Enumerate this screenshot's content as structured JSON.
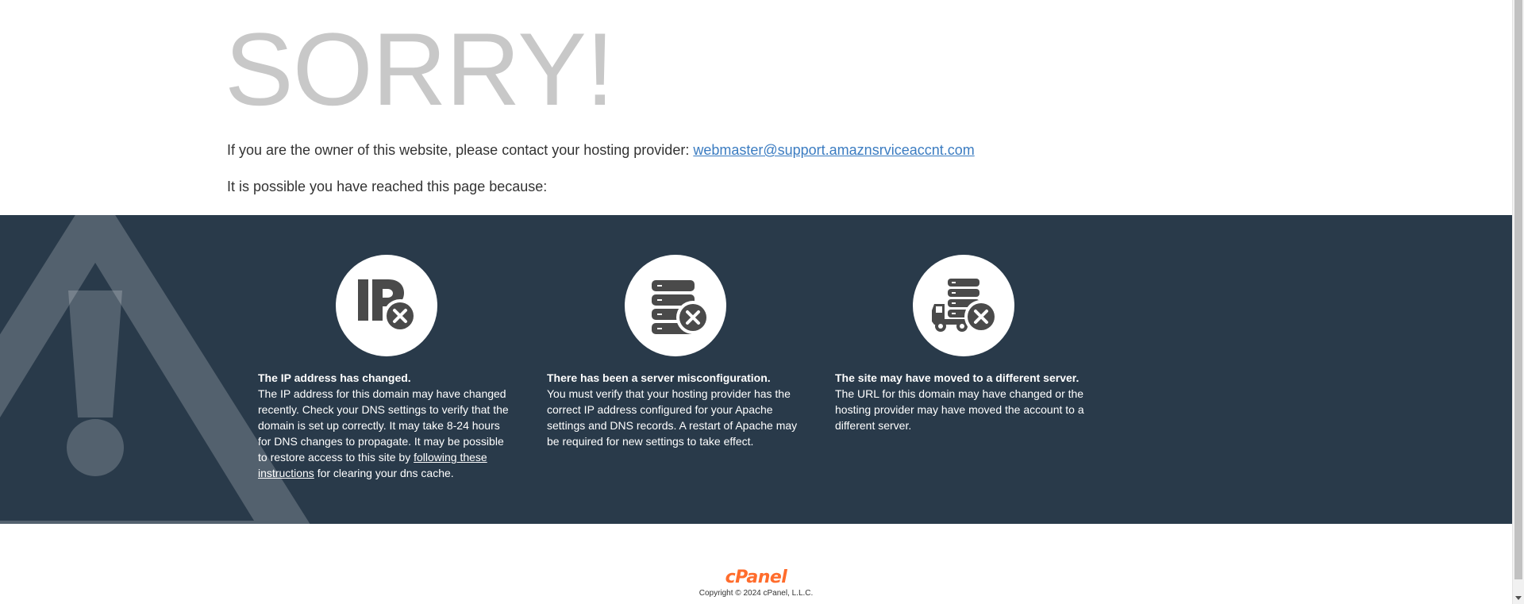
{
  "heading": "SORRY!",
  "owner_prefix": "If you are the owner of this website, please contact your hosting provider: ",
  "owner_email": "webmaster@support.amaznsrviceaccnt.com",
  "reason_intro": "It is possible you have reached this page because:",
  "reasons": [
    {
      "icon": "ip-address-error-icon",
      "title": "The IP address has changed.",
      "body_before_link": "The IP address for this domain may have changed recently. Check your DNS settings to verify that the domain is set up correctly. It may take 8-24 hours for DNS changes to propagate. It may be possible to restore access to this site by ",
      "link_text": "following these instructions",
      "body_after_link": " for clearing your dns cache."
    },
    {
      "icon": "server-error-icon",
      "title": "There has been a server misconfiguration.",
      "body": "You must verify that your hosting provider has the correct IP address configured for your Apache settings and DNS records. A restart of Apache may be required for new settings to take effect."
    },
    {
      "icon": "server-moved-icon",
      "title": "The site may have moved to a different server.",
      "body": "The URL for this domain may have changed or the hosting provider may have moved the account to a different server."
    }
  ],
  "footer": {
    "logo_text": "cPanel",
    "copyright": "Copyright © 2024 cPanel, L.L.C."
  },
  "colors": {
    "band": "#293a4a",
    "heading": "#c8c8c8",
    "link": "#3b7cc1",
    "icon": "#4a4a4a",
    "logo": "#ff6c2c"
  }
}
